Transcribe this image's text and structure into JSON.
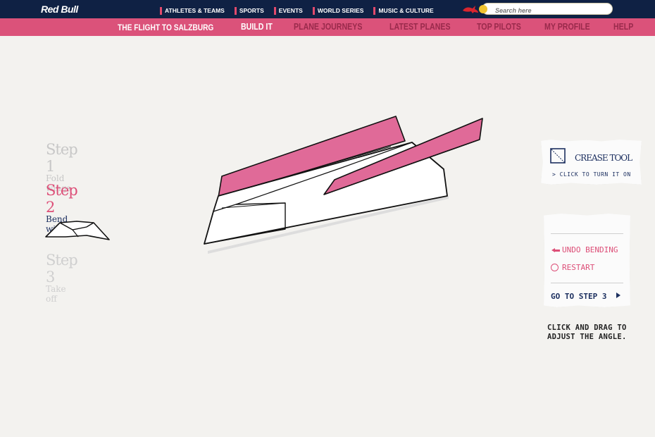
{
  "header": {
    "logo": "Red Bull",
    "nav": [
      "ATHLETES & TEAMS",
      "SPORTS",
      "EVENTS",
      "WORLD SERIES",
      "MUSIC & CULTURE"
    ],
    "search_placeholder": "Search here"
  },
  "subnav": {
    "title": "THE FLIGHT TO SALZBURG",
    "items": [
      "BUILD IT",
      "PLANE JOURNEYS",
      "LATEST PLANES",
      "TOP PILOTS",
      "MY PROFILE",
      "HELP"
    ],
    "active": "BUILD IT"
  },
  "steps": [
    {
      "heading": "Step 1",
      "sub": "Fold wings",
      "state": "done"
    },
    {
      "heading": "Step 2",
      "sub": "Bend wings",
      "state": "current"
    },
    {
      "heading": "Step 3",
      "sub": "Take off",
      "state": "next"
    }
  ],
  "crease_tool": {
    "title": "CREASE TOOL",
    "subtitle": "> CLICK TO TURN IT ON"
  },
  "actions": {
    "undo": "UNDO BENDING",
    "restart": "RESTART",
    "next": "GO TO STEP 3"
  },
  "hint": "CLICK AND DRAG TO ADJUST THE ANGLE.",
  "colors": {
    "navy": "#0f2144",
    "pink": "#db527a",
    "accent": "#dd4f78",
    "ink": "#1d3060"
  }
}
